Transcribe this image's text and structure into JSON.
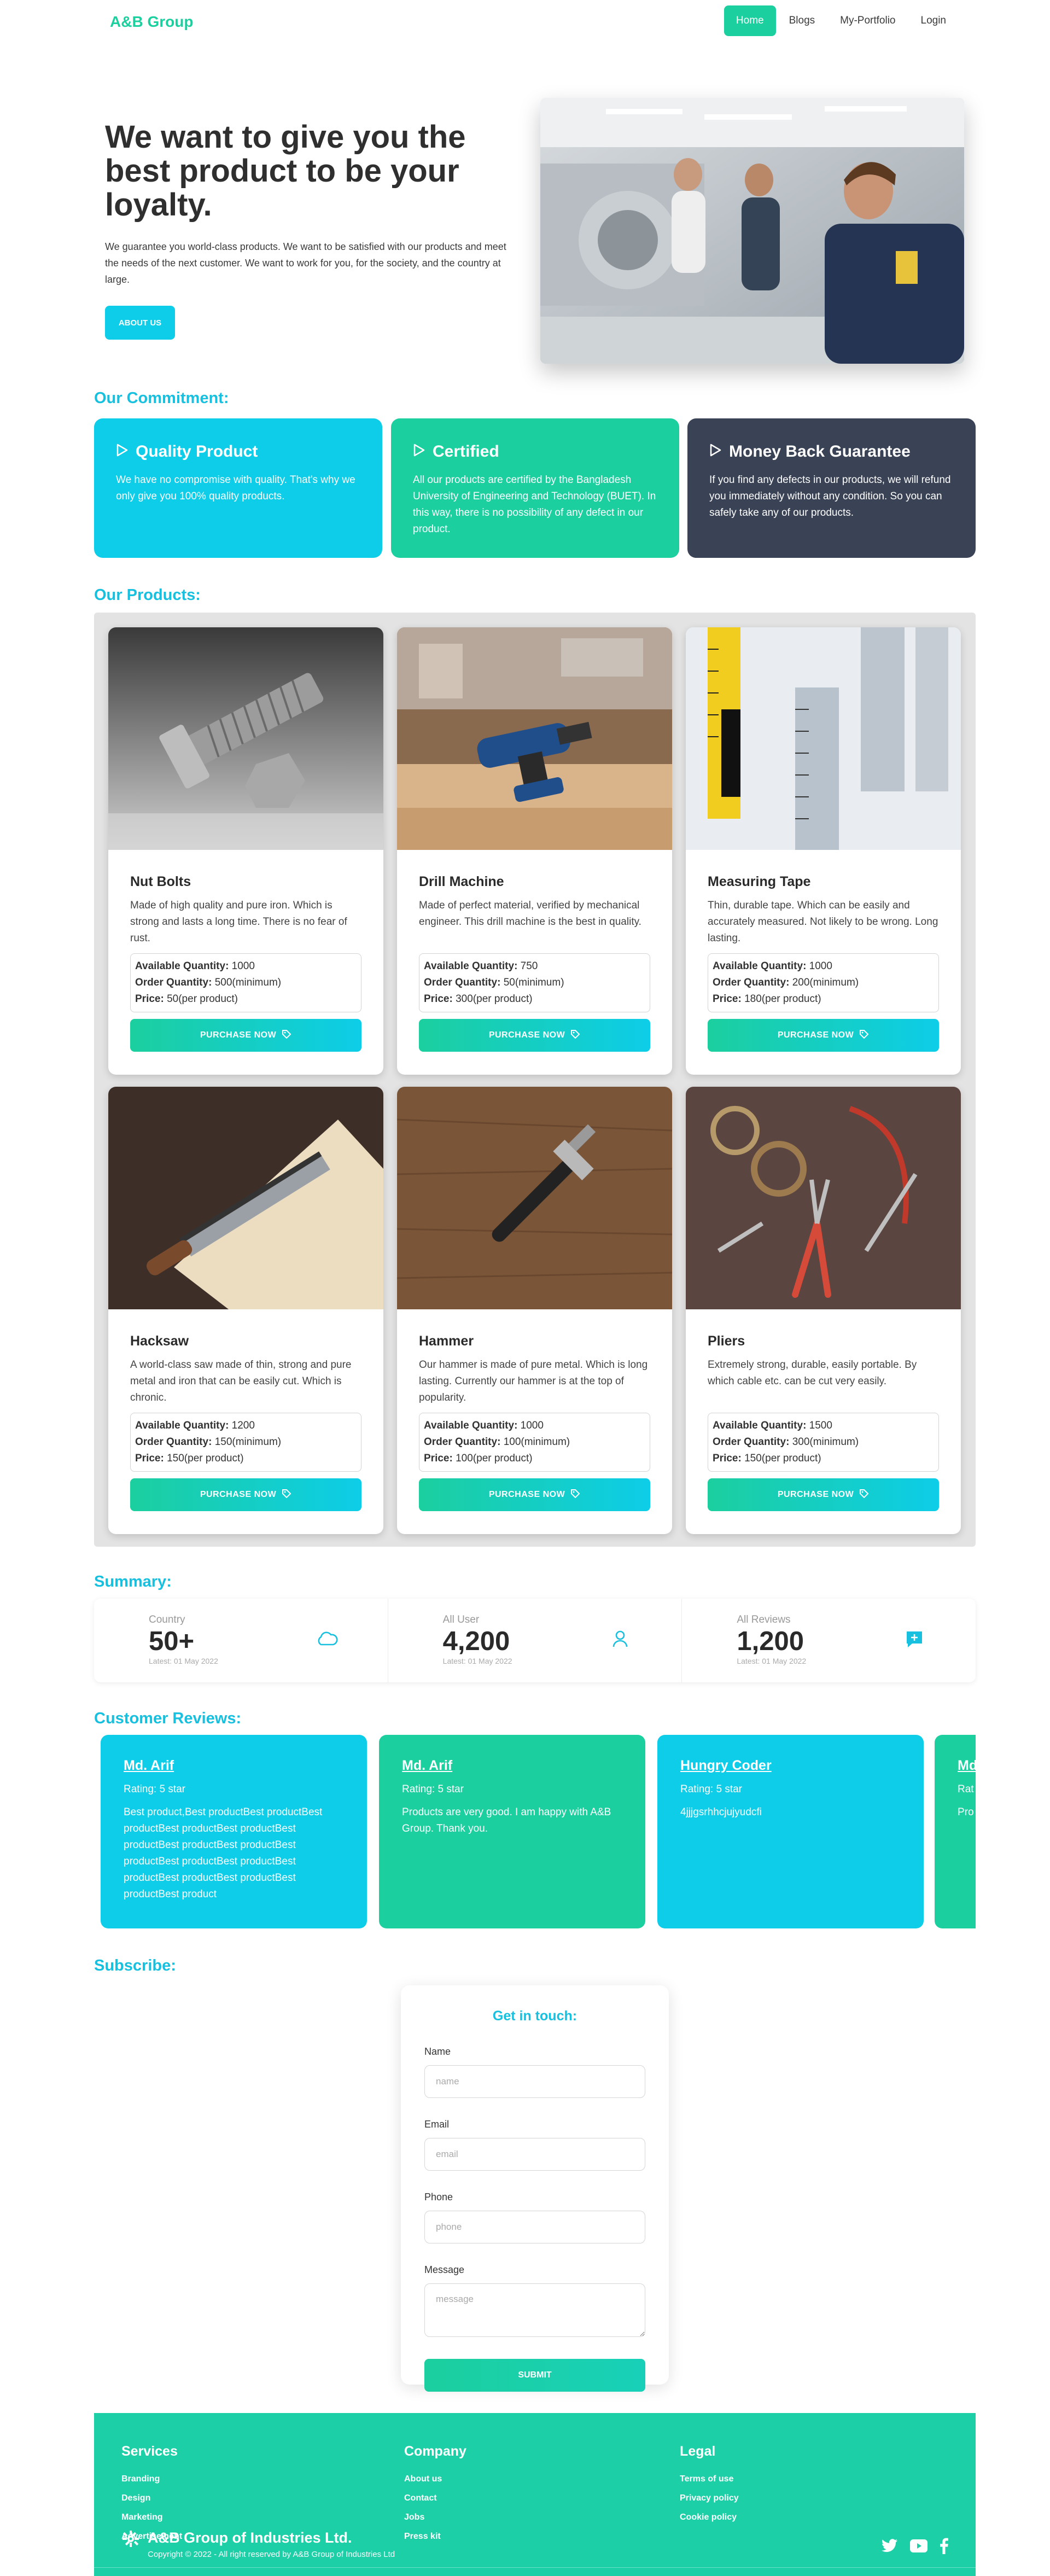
{
  "nav": {
    "brand": "A&B Group",
    "links": [
      "Home",
      "Blogs",
      "My-Portfolio",
      "Login"
    ]
  },
  "hero": {
    "title": "We want to give you the best product to be your loyalty.",
    "text": "We guarantee you world-class products. We want to be satisfied with our products and meet the needs of the next customer. We want to work for you, for the society, and the country at large.",
    "button": "ABOUT US"
  },
  "commitment": {
    "title": "Our Commitment:",
    "cards": [
      {
        "title": "Quality Product",
        "text": "We have no compromise with quality. That's why we only give you 100% quality products.",
        "color": "#0dcde8"
      },
      {
        "title": "Certified",
        "text": "All our products are certified by the Bangladesh University of Engineering and Technology (BUET). In this way, there is no possibility of any defect in our product.",
        "color": "#1ccf9f"
      },
      {
        "title": "Money Back Guarantee",
        "text": "If you find any defects in our products, we will refund you immediately without any condition. So you can safely take any of our products.",
        "color": "#3a4256"
      }
    ]
  },
  "products": {
    "title": "Our Products:",
    "qty_label": "Available Quantity:",
    "order_label": "Order Quantity:",
    "price_label": "Price:",
    "button": "PURCHASE NOW",
    "items": [
      {
        "name": "Nut Bolts",
        "desc": "Made of high quality and pure iron. Which is strong and lasts a long time. There is no fear of rust.",
        "qty": "1000",
        "order": "500(minimum)",
        "price": "50(per product)"
      },
      {
        "name": "Drill Machine",
        "desc": "Made of perfect material, verified by mechanical engineer. This drill machine is the best in quality.",
        "qty": "750",
        "order": "50(minimum)",
        "price": "300(per product)"
      },
      {
        "name": "Measuring Tape",
        "desc": "Thin, durable tape. Which can be easily and accurately measured. Not likely to be wrong. Long lasting.",
        "qty": "1000",
        "order": "200(minimum)",
        "price": "180(per product)"
      },
      {
        "name": "Hacksaw",
        "desc": "A world-class saw made of thin, strong and pure metal and iron that can be easily cut. Which is chronic.",
        "qty": "1200",
        "order": "150(minimum)",
        "price": "150(per product)"
      },
      {
        "name": "Hammer",
        "desc": "Our hammer is made of pure metal. Which is long lasting. Currently our hammer is at the top of popularity.",
        "qty": "1000",
        "order": "100(minimum)",
        "price": "100(per product)"
      },
      {
        "name": "Pliers",
        "desc": "Extremely strong, durable, easily portable. By which cable etc. can be cut very easily.",
        "qty": "1500",
        "order": "300(minimum)",
        "price": "150(per product)"
      }
    ]
  },
  "summary": {
    "title": "Summary:",
    "stats": [
      {
        "label": "Country",
        "value": "50+",
        "date": "Latest: 01 May 2022",
        "icon": "cloud-icon"
      },
      {
        "label": "All User",
        "value": "4,200",
        "date": "Latest: 01 May 2022",
        "icon": "user-icon"
      },
      {
        "label": "All Reviews",
        "value": "1,200",
        "date": "Latest: 01 May 2022",
        "icon": "message-plus-icon"
      }
    ]
  },
  "reviews": {
    "title": "Customer Reviews:",
    "items": [
      {
        "name": "Md. Arif",
        "rating": "Rating: 5 star",
        "text": "Best product,Best productBest productBest productBest productBest productBest productBest productBest productBest productBest productBest productBest productBest productBest productBest productBest product",
        "color": "#0dcde8"
      },
      {
        "name": "Md. Arif",
        "rating": "Rating: 5 star",
        "text": "Products are very good. I am happy with A&B Group. Thank you.",
        "color": "#1ccf9f"
      },
      {
        "name": "Hungry Coder",
        "rating": "Rating: 5 star",
        "text": "4jjjgsrhhcjujyudcfi",
        "color": "#0dcde8"
      },
      {
        "name": "Md",
        "rating": "Rat",
        "text": "Pro",
        "color": "#1ccf9f"
      }
    ]
  },
  "subscribe": {
    "title": "Subscribe:",
    "form_title": "Get in touch:",
    "name_label": "Name",
    "name_placeholder": "name",
    "email_label": "Email",
    "email_placeholder": "email",
    "phone_label": "Phone",
    "phone_placeholder": "phone",
    "message_label": "Message",
    "message_placeholder": "message",
    "submit": "SUBMIT"
  },
  "footer": {
    "columns": [
      {
        "title": "Services",
        "links": [
          "Branding",
          "Design",
          "Marketing",
          "Advertisement"
        ]
      },
      {
        "title": "Company",
        "links": [
          "About us",
          "Contact",
          "Jobs",
          "Press kit"
        ]
      },
      {
        "title": "Legal",
        "links": [
          "Terms of use",
          "Privacy policy",
          "Cookie policy"
        ]
      }
    ],
    "brand": "A&B Group of Industries Ltd.",
    "copyright": "Copyright © 2022 - All right reserved by A&B Group of Industries Ltd",
    "social": [
      "twitter-icon",
      "youtube-icon",
      "facebook-icon"
    ]
  }
}
